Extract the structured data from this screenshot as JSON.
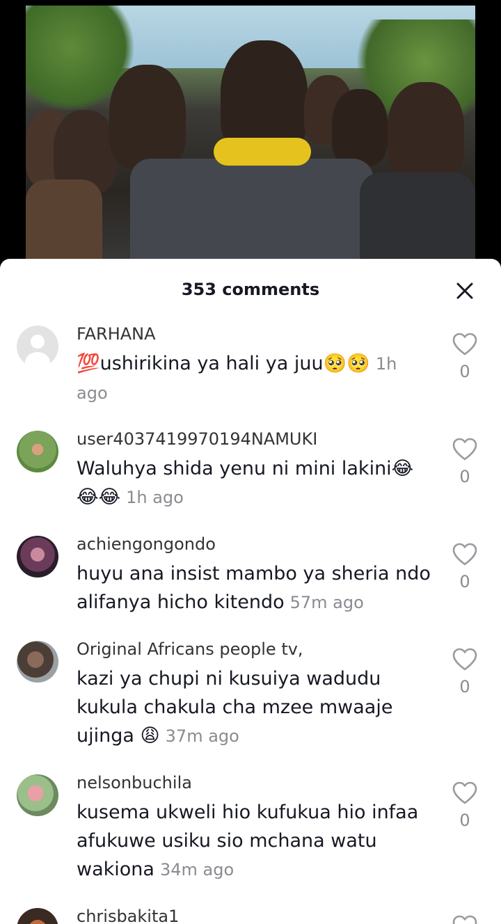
{
  "video": {},
  "sheet": {
    "title": "353 comments"
  },
  "comments": [
    {
      "username": "FARHANA",
      "prefix": "💯",
      "text": "ushirikina ya hali ya juu🥺🥺",
      "time": "1h ago",
      "likes": "0",
      "avatar": "default-avatar"
    },
    {
      "username": "user4037419970194NAMUKI",
      "prefix": "",
      "text": "Waluhya shida yenu ni mini lakini😂😂😂",
      "time": "1h ago",
      "likes": "0",
      "avatar": "user-avatar"
    },
    {
      "username": "achiengongondo",
      "prefix": "",
      "text": "huyu ana insist mambo ya sheria ndo alifanya hicho kitendo",
      "time": "57m ago",
      "likes": "0",
      "avatar": "user-avatar"
    },
    {
      "username": "Original Africans people tv,",
      "prefix": "",
      "text": "kazi ya chupi ni kusuiya wadudu kukula chakula cha mzee mwaaje ujinga 😩",
      "time": "37m ago",
      "likes": "0",
      "avatar": "user-avatar"
    },
    {
      "username": "nelsonbuchila",
      "prefix": "",
      "text": "kusema ukweli hio kufukua hio infaa afukuwe usiku sio mchana watu wakiona",
      "time": "34m ago",
      "likes": "0",
      "avatar": "user-avatar"
    },
    {
      "username": "chrisbakita1",
      "prefix": "",
      "text": "",
      "time": "",
      "likes": "",
      "avatar": "user-avatar"
    }
  ],
  "icons": {
    "close": "close-icon",
    "like": "heart-outline-icon"
  },
  "colors": {
    "sheet_bg": "#ffffff",
    "text": "#161823",
    "muted": "#8a8b91"
  }
}
